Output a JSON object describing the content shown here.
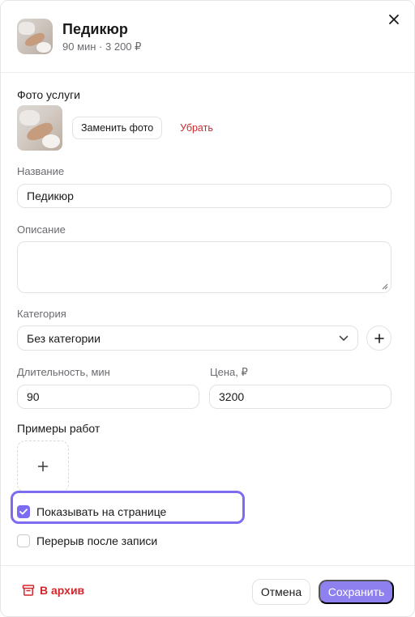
{
  "header": {
    "title": "Педикюр",
    "subtitle": "90 мин · 3 200 ₽"
  },
  "photo": {
    "section_label": "Фото услуги",
    "replace_label": "Заменить фото",
    "remove_label": "Убрать"
  },
  "name_field": {
    "label": "Название",
    "value": "Педикюр"
  },
  "description_field": {
    "label": "Описание",
    "value": ""
  },
  "category_field": {
    "label": "Категория",
    "selected": "Без категории"
  },
  "duration_field": {
    "label": "Длительность, мин",
    "value": "90"
  },
  "price_field": {
    "label": "Цена, ₽",
    "value": "3200"
  },
  "examples": {
    "section_label": "Примеры работ"
  },
  "options": {
    "show_on_page": {
      "label": "Показывать на странице",
      "checked": true
    },
    "break_after": {
      "label": "Перерыв после записи",
      "checked": false
    }
  },
  "footer": {
    "archive_label": "В архив",
    "cancel_label": "Отмена",
    "save_label": "Сохранить"
  },
  "colors": {
    "accent": "#8f80f0",
    "focus_ring": "#7b6cf0",
    "danger": "#d2262c"
  },
  "icons": [
    "close-icon",
    "plus-icon",
    "chevron-down-icon",
    "checkmark-icon",
    "archive-box-icon",
    "resize-grip-icon"
  ]
}
